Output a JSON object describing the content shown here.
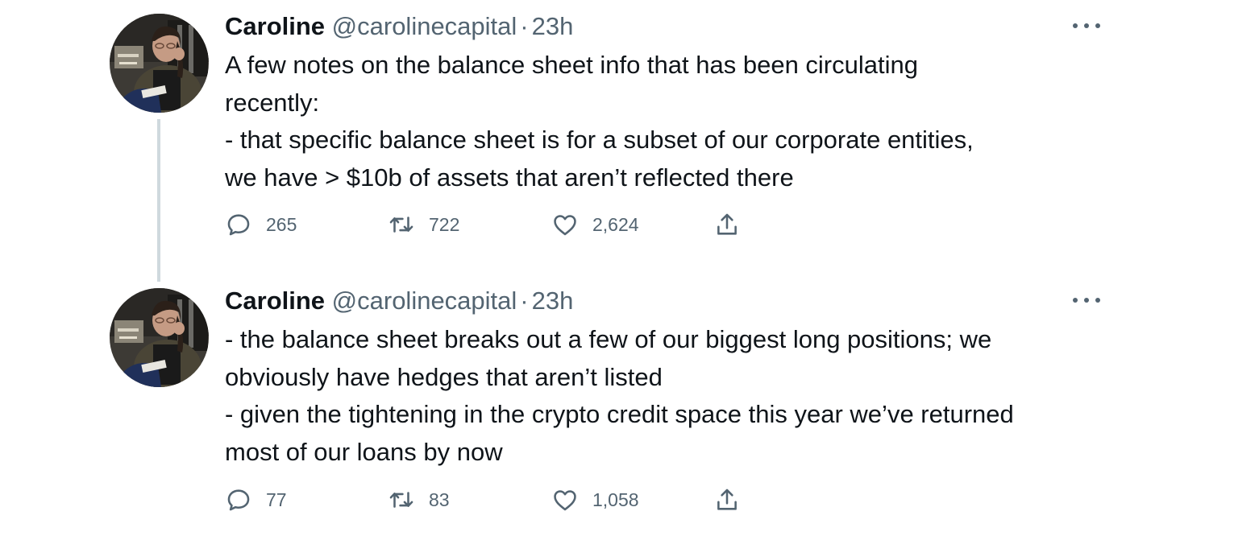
{
  "tweets": [
    {
      "name": "Caroline",
      "handle": "@carolinecapital",
      "separator": "·",
      "time": "23h",
      "avatar_icon": "profile-photo",
      "body_lines": [
        "A few notes on the balance sheet info that has been circulating",
        "recently:",
        "- that specific balance sheet is for a subset of our corporate entities,",
        "we have > $10b of assets that aren’t reflected there"
      ],
      "replies": "265",
      "retweets": "722",
      "likes": "2,624"
    },
    {
      "name": "Caroline",
      "handle": "@carolinecapital",
      "separator": "·",
      "time": "23h",
      "avatar_icon": "profile-photo",
      "body_lines": [
        "- the balance sheet breaks out a few of our biggest long positions; we",
        "obviously have hedges that aren’t listed",
        "- given the tightening in the crypto credit space this year we’ve returned",
        "most of our loans by now"
      ],
      "replies": "77",
      "retweets": "83",
      "likes": "1,058"
    }
  ],
  "icons": {
    "more": "more-horizontal-icon",
    "reply": "reply-bubble-icon",
    "retweet": "retweet-arrows-icon",
    "like": "heart-icon",
    "share": "share-upload-icon"
  },
  "colors": {
    "text": "#0f1419",
    "secondary": "#536471",
    "thread_line": "#cfd9de",
    "background": "#ffffff"
  }
}
